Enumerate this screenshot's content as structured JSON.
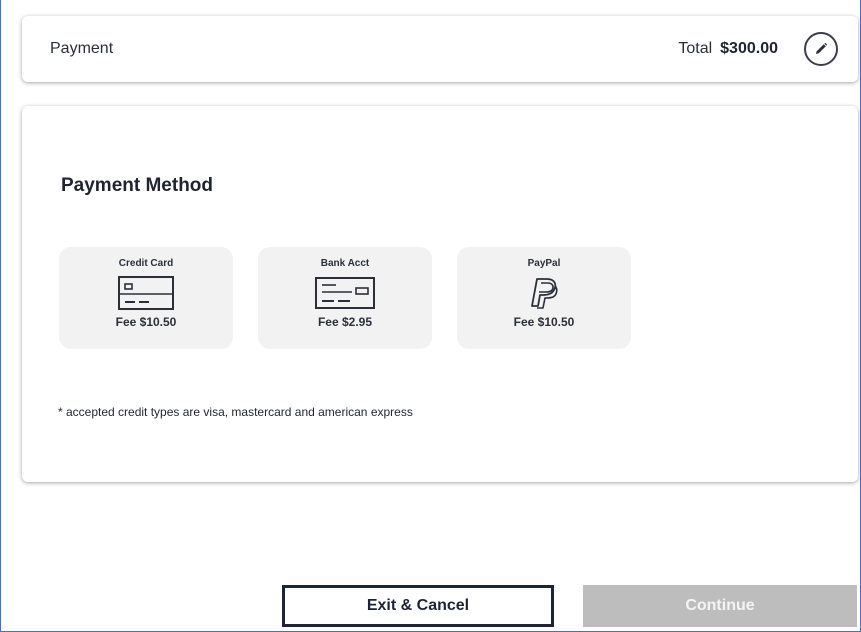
{
  "summary": {
    "title": "Payment",
    "total_label": "Total",
    "total_amount": "$300.00"
  },
  "payment_method": {
    "heading": "Payment Method",
    "options": [
      {
        "label": "Credit Card",
        "fee": "Fee $10.50",
        "icon": "credit-card-icon"
      },
      {
        "label": "Bank Acct",
        "fee": "Fee $2.95",
        "icon": "bank-check-icon"
      },
      {
        "label": "PayPal",
        "fee": "Fee $10.50",
        "icon": "paypal-icon"
      }
    ],
    "note": "* accepted credit types are visa, mastercard and american express"
  },
  "actions": {
    "exit_label": "Exit & Cancel",
    "continue_label": "Continue"
  },
  "colors": {
    "primary_dark": "#1d2433",
    "option_bg": "#f2f2f3",
    "disabled_button": "#bdbdbd"
  }
}
